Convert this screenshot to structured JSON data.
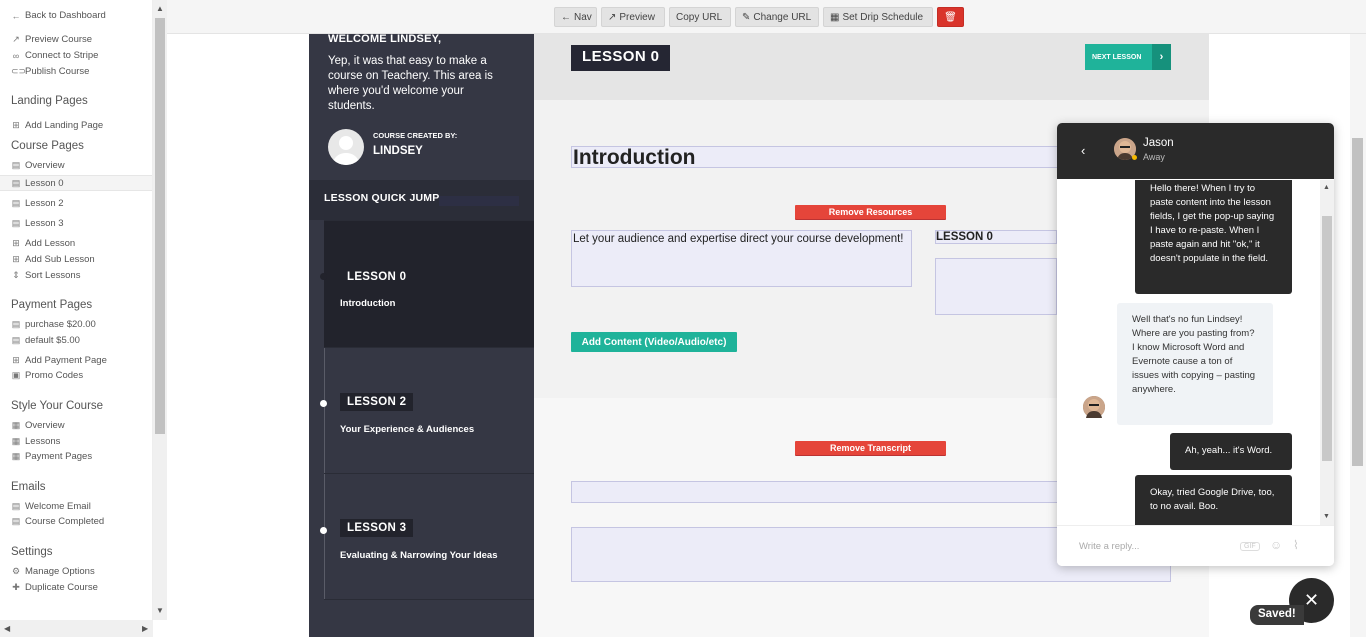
{
  "sidebar": {
    "back": "Back to Dashboard",
    "top_links": [
      "Preview Course",
      "Connect to Stripe",
      "Publish Course"
    ],
    "landing_head": "Landing Pages",
    "landing_links": [
      "Add Landing Page"
    ],
    "course_head": "Course Pages",
    "course_links": [
      "Overview",
      "Lesson 0",
      "Lesson 2",
      "Lesson 3",
      "Add Lesson",
      "Add Sub Lesson",
      "Sort Lessons"
    ],
    "payment_head": "Payment Pages",
    "payment_links": [
      "purchase $20.00",
      "default $5.00",
      "Add Payment Page",
      "Promo Codes"
    ],
    "style_head": "Style Your Course",
    "style_links": [
      "Overview",
      "Lessons",
      "Payment Pages"
    ],
    "emails_head": "Emails",
    "emails_links": [
      "Welcome Email",
      "Course Completed"
    ],
    "settings_head": "Settings",
    "settings_links": [
      "Manage Options",
      "Duplicate Course"
    ]
  },
  "toolbar": {
    "nav": "Nav",
    "preview": "Preview",
    "copy_url": "Copy URL",
    "change_url": "Change URL",
    "drip": "Set Drip Schedule"
  },
  "lesson_nav": {
    "welcome_title": "WELCOME LINDSEY,",
    "welcome_text": "Yep, it was that easy to make a course on Teachery. This area is where you'd welcome your students.",
    "created_by_label": "COURSE CREATED BY:",
    "created_by_name": "LINDSEY",
    "quick_jump": "LESSON QUICK JUMP",
    "lessons": [
      {
        "tag": "LESSON 0",
        "title": "Introduction"
      },
      {
        "tag": "LESSON 2",
        "title": "Your Experience & Audiences"
      },
      {
        "tag": "LESSON 3",
        "title": "Evaluating & Narrowing Your Ideas"
      }
    ]
  },
  "main": {
    "lesson_badge": "LESSON 0",
    "next_lesson": "NEXT LESSON",
    "intro_title": "Introduction",
    "remove_resources": "Remove Resources",
    "description": "Let your audience and expertise direct your course development!",
    "lesson_field": "LESSON 0",
    "add_content": "Add Content (Video/Audio/etc)",
    "remove_transcript": "Remove Transcript"
  },
  "chat": {
    "name": "Jason",
    "status": "Away",
    "messages": [
      "Hello there! When I try to paste content into the lesson fields, I get the pop-up saying I have to re-paste. When I paste again and hit \"ok,\" it doesn't populate in the field.",
      "Well that's no fun Lindsey! Where are you pasting from? I know Microsoft Word and Evernote cause a ton of issues with copying – pasting anywhere.",
      "Ah, yeah... it's Word.",
      "Okay, tried Google Drive, too, to no avail. Boo."
    ],
    "placeholder": "Write a reply...",
    "gif_label": "GIF"
  },
  "saved": "Saved!"
}
